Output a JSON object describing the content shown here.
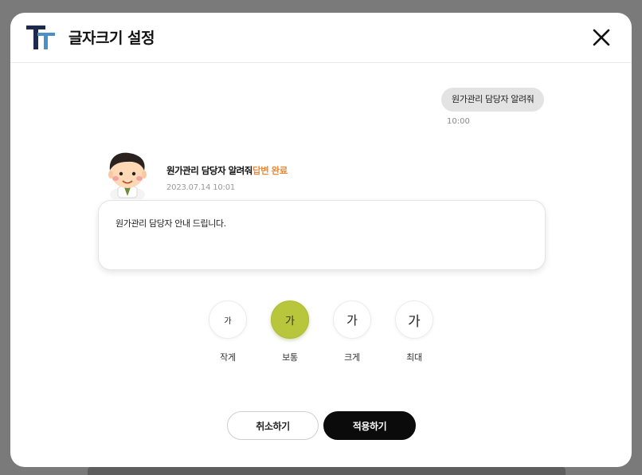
{
  "modal": {
    "title": "글자크기 설정"
  },
  "chat": {
    "user_message": "원가관리 담당자 알려줘",
    "user_time": "10:00",
    "bot_question": "원가관리 담당자 알려줘",
    "bot_status": "답변 완료",
    "bot_time": "2023.07.14 10:01",
    "bot_answer": "원가관리 담당자 안내 드립니다."
  },
  "font_size": {
    "selected": "보통",
    "options": [
      {
        "glyph": "가",
        "label": "작게"
      },
      {
        "glyph": "가",
        "label": "보통"
      },
      {
        "glyph": "가",
        "label": "크게"
      },
      {
        "glyph": "가",
        "label": "최대"
      }
    ]
  },
  "buttons": {
    "cancel": "취소하기",
    "apply": "적용하기"
  },
  "colors": {
    "accent_selected": "#b7c63a",
    "status_done": "#e88a3a",
    "primary_button": "#0b0b0b"
  },
  "icons": {
    "logo": "tt-font-logo",
    "close": "close-icon",
    "avatar": "chatbot-avatar"
  }
}
